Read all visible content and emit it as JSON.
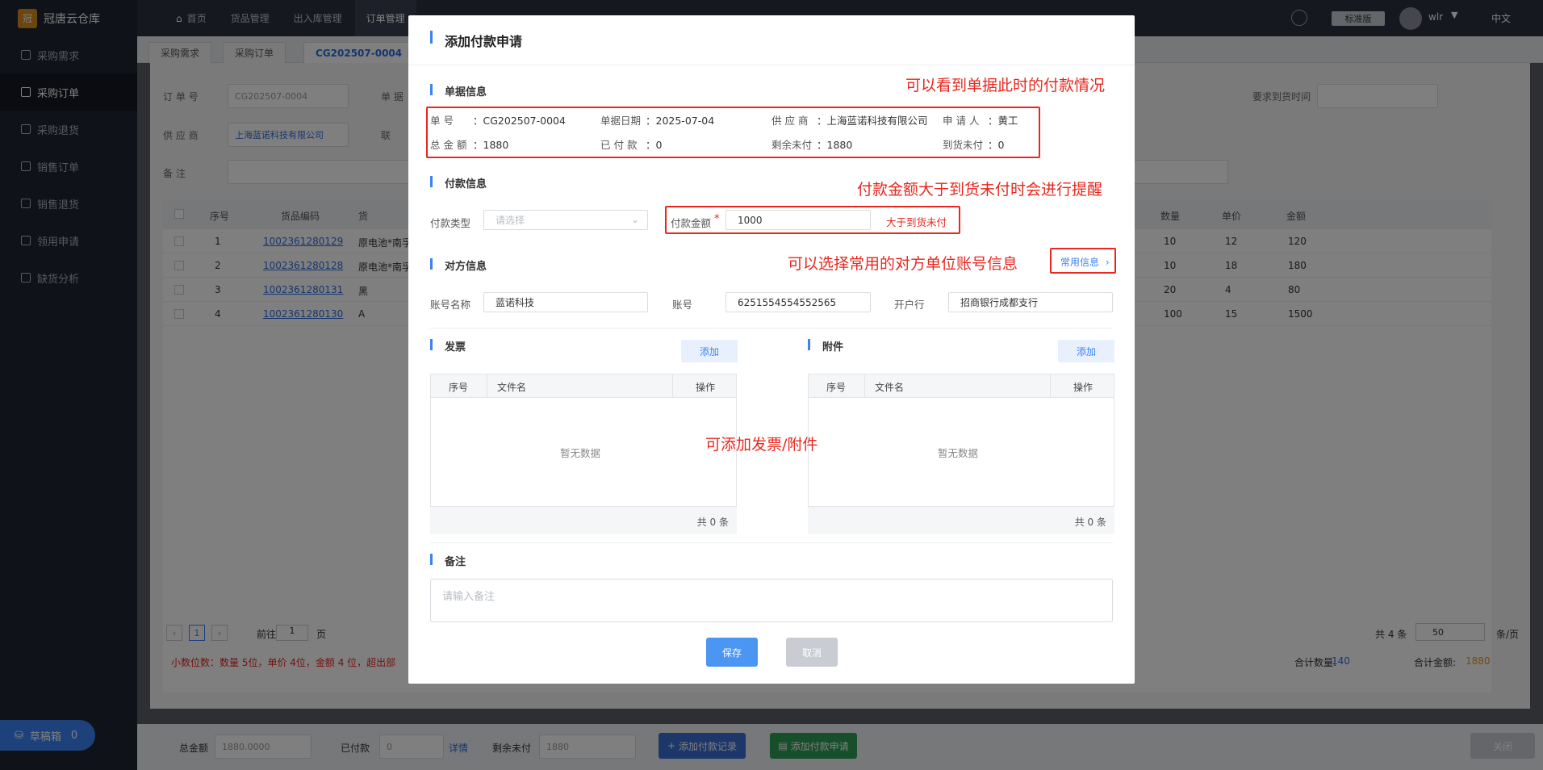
{
  "app": {
    "logo_text": "冠唐云仓库",
    "logo_mark": "冠"
  },
  "sidebar": {
    "items": [
      {
        "label": "采购需求"
      },
      {
        "label": "采购订单"
      },
      {
        "label": "采购退货"
      },
      {
        "label": "销售订单"
      },
      {
        "label": "销售退货"
      },
      {
        "label": "领用申请"
      },
      {
        "label": "缺货分析"
      }
    ],
    "draft_label": "草稿箱",
    "draft_count": "0"
  },
  "topnav": {
    "items": [
      {
        "label": "首页"
      },
      {
        "label": "货品管理"
      },
      {
        "label": "出入库管理"
      },
      {
        "label": "订单管理"
      }
    ],
    "edition": "标准版",
    "user": "wlr",
    "lang": "中文"
  },
  "tabs": [
    {
      "label": "采购需求"
    },
    {
      "label": "采购订单"
    },
    {
      "label": "CG202507-0004【"
    }
  ],
  "order_form": {
    "order_no_label": "订  单  号",
    "order_no_value": "CG202507-0004",
    "doc_label": "单  据",
    "supplier_label": "供  应  商",
    "supplier_value": "上海蓝诺科技有限公司",
    "contact_label": "联",
    "remark_label": "备        注",
    "required_date_label": "要求到货时间"
  },
  "order_table": {
    "headers": [
      "序号",
      "货品编码",
      "货"
    ],
    "right_headers": [
      "数量",
      "单价",
      "金额"
    ],
    "rows": [
      {
        "no": "1",
        "code": "1002361280129",
        "name": "原电池*南孚",
        "qty": "10",
        "price": "12",
        "amount": "120"
      },
      {
        "no": "2",
        "code": "1002361280128",
        "name": "原电池*南孚",
        "qty": "10",
        "price": "18",
        "amount": "180"
      },
      {
        "no": "3",
        "code": "1002361280131",
        "name": "黑",
        "qty": "20",
        "price": "4",
        "amount": "80"
      },
      {
        "no": "4",
        "code": "1002361280130",
        "name": "A",
        "qty": "100",
        "price": "15",
        "amount": "1500"
      }
    ],
    "pager_current": "1",
    "goto_prefix": "前往",
    "goto_value": "1",
    "goto_suffix": "页",
    "total_text": "共 4 条",
    "page_size": "50",
    "page_size_suffix": "条/页",
    "decimal_note": "小数位数：数量 5位，单价 4位，金额 4 位，超出部",
    "total_qty_label": "合计数量:",
    "total_qty_value": "140",
    "total_amount_label": "合计金额:",
    "total_amount_value": "1880"
  },
  "bottombar": {
    "total_label": "总金额",
    "total_value": "1880.0000",
    "paid_label": "已付款",
    "paid_value": "0",
    "detail_link": "详情",
    "remaining_label": "剩余未付",
    "remaining_value": "1880",
    "add_record_btn": "添加付款记录",
    "add_apply_btn": "添加付款申请",
    "close_btn": "关闭"
  },
  "modal": {
    "title": "添加付款申请",
    "doc_section": "单据信息",
    "doc": {
      "no_label": "单    号",
      "no_value": "：CG202507-0004",
      "date_label": "单据日期",
      "date_value": "：2025-07-04",
      "supplier_label": "供 应 商",
      "supplier_value": "：上海蓝诺科技有限公司",
      "applicant_label": "申 请 人",
      "applicant_value": "：黄工",
      "total_label": "总 金 额",
      "total_value": "：1880",
      "paid_label": "已 付 款",
      "paid_value": "：0",
      "remaining_label": "剩余未付",
      "remaining_value": "：1880",
      "arrival_unpaid_label": "到货未付",
      "arrival_unpaid_value": "：0"
    },
    "pay_section": "付款信息",
    "pay_type_label": "付款类型",
    "pay_type_placeholder": "请选择",
    "pay_amount_label": "付款金额",
    "required_mark": "*",
    "pay_amount_value": "1000",
    "pay_amount_warning": "大于到货未付",
    "party_section": "对方信息",
    "common_info_link": "常用信息",
    "account_name_label": "账号名称",
    "account_name_value": "蓝诺科技",
    "account_no_label": "账号",
    "account_no_value": "6251554554552565",
    "bank_label": "开户行",
    "bank_value": "招商银行成都支行",
    "invoice_section": "发票",
    "attach_section": "附件",
    "add_label": "添加",
    "grid_headers": [
      "序号",
      "文件名",
      "操作"
    ],
    "empty_text": "暂无数据",
    "grid_total": "共 0 条",
    "remark_section": "备注",
    "remark_placeholder": "请输入备注",
    "save_btn": "保存",
    "cancel_btn": "取消"
  },
  "annotations": {
    "doc_status": "可以看到单据此时的付款情况",
    "amount_warning": "付款金额大于到货未付时会进行提醒",
    "common_info": "可以选择常用的对方单位账号信息",
    "attachments": "可添加发票/附件"
  },
  "colors": {
    "annotation": "#e8271f",
    "accent": "#3b82f6",
    "sidebar": "#1e2430"
  }
}
